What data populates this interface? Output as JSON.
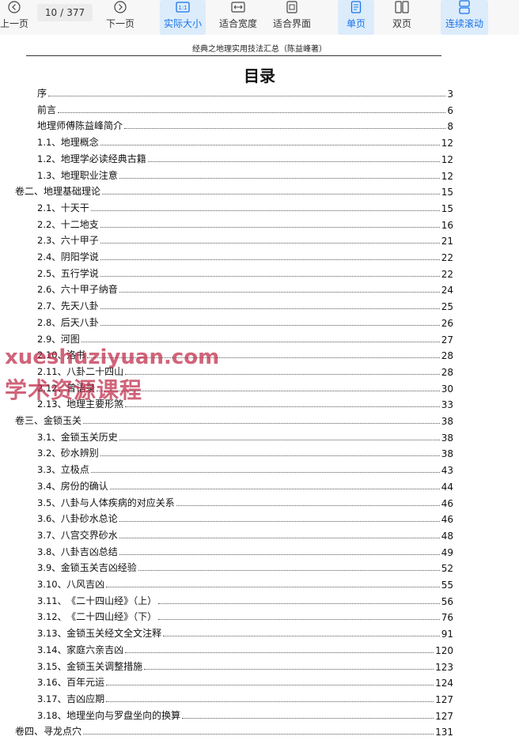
{
  "toolbar": {
    "prev_label": "上一页",
    "page_current": "10",
    "page_sep": "/",
    "page_total": "377",
    "next_label": "下一页",
    "actual_size_label": "实际大小",
    "fit_width_label": "适合宽度",
    "fit_page_label": "适合界面",
    "single_page_label": "单页",
    "double_page_label": "双页",
    "continuous_label": "连续滚动",
    "accent": "#1a73e8"
  },
  "document": {
    "header": "经典之地理实用技法汇总（陈益峰著）",
    "title": "目录",
    "toc": [
      {
        "num": "",
        "text": "序",
        "page": "3"
      },
      {
        "num": "",
        "text": "前言",
        "page": "6"
      },
      {
        "num": "",
        "text": "地理师傅陈益峰简介",
        "page": "8"
      },
      {
        "num": "1.1、",
        "text": "地理概念",
        "page": "12"
      },
      {
        "num": "1.2、",
        "text": "地理学必读经典古籍",
        "page": "12"
      },
      {
        "num": "1.3、",
        "text": "地理职业注意",
        "page": "12"
      },
      {
        "num": "",
        "text": "卷二、地理基础理论",
        "page": "15"
      },
      {
        "num": "2.1、",
        "text": "十天干",
        "page": "15"
      },
      {
        "num": "2.2、",
        "text": "十二地支",
        "page": "16"
      },
      {
        "num": "2.3、",
        "text": "六十甲子",
        "page": "21"
      },
      {
        "num": "2.4、",
        "text": "阴阳学说",
        "page": "22"
      },
      {
        "num": "2.5、",
        "text": "五行学说",
        "page": "22"
      },
      {
        "num": "2.6、",
        "text": "六十甲子纳音",
        "page": "24"
      },
      {
        "num": "2.7、",
        "text": "先天八卦",
        "page": "25"
      },
      {
        "num": "2.8、",
        "text": "后天八卦",
        "page": "26"
      },
      {
        "num": "2.9、",
        "text": "河图",
        "page": "27"
      },
      {
        "num": "2.10、",
        "text": "洛书",
        "page": "28"
      },
      {
        "num": "2.11、",
        "text": "八卦二十四山",
        "page": "28"
      },
      {
        "num": "2.12、",
        "text": "曾语录",
        "page": "30"
      },
      {
        "num": "2.13、",
        "text": "地理主要形煞",
        "page": "33"
      },
      {
        "num": "",
        "text": "卷三、金锁玉关",
        "page": "38"
      },
      {
        "num": "3.1、",
        "text": "金锁玉关历史",
        "page": "38"
      },
      {
        "num": "3.2、",
        "text": "砂水辨别",
        "page": "38"
      },
      {
        "num": "3.3、",
        "text": "立极点",
        "page": "43"
      },
      {
        "num": "3.4、",
        "text": "房份的确认",
        "page": "44"
      },
      {
        "num": "3.5、",
        "text": "八卦与人体疾病的对应关系",
        "page": "46"
      },
      {
        "num": "3.6、",
        "text": "八卦砂水总论",
        "page": "46"
      },
      {
        "num": "3.7、",
        "text": "八宫交界砂水",
        "page": "48"
      },
      {
        "num": "3.8、",
        "text": "八卦吉凶总结",
        "page": "49"
      },
      {
        "num": "3.9、",
        "text": "金锁玉关吉凶经验",
        "page": "52"
      },
      {
        "num": "3.10、",
        "text": "八风吉凶",
        "page": "55"
      },
      {
        "num": "3.11、",
        "text": "《二十四山经》（上）",
        "page": "56"
      },
      {
        "num": "3.12、",
        "text": "《二十四山经》（下）",
        "page": "76"
      },
      {
        "num": "3.13、",
        "text": "金锁玉关经文全文注释",
        "page": "91"
      },
      {
        "num": "3.14、",
        "text": "家庭六亲吉凶",
        "page": "120"
      },
      {
        "num": "3.15、",
        "text": "金锁玉关调整措施",
        "page": "123"
      },
      {
        "num": "3.16、",
        "text": "百年元运",
        "page": "124"
      },
      {
        "num": "3.17、",
        "text": "吉凶应期",
        "page": "127"
      },
      {
        "num": "3.18、",
        "text": "地理坐向与罗盘坐向的换算",
        "page": "127"
      },
      {
        "num": "",
        "text": "卷四、寻龙点穴",
        "page": "131"
      }
    ]
  },
  "watermark": {
    "line1": "xueshuziyuan.com",
    "line2": "学术资源课程",
    "color": "#be2846"
  }
}
